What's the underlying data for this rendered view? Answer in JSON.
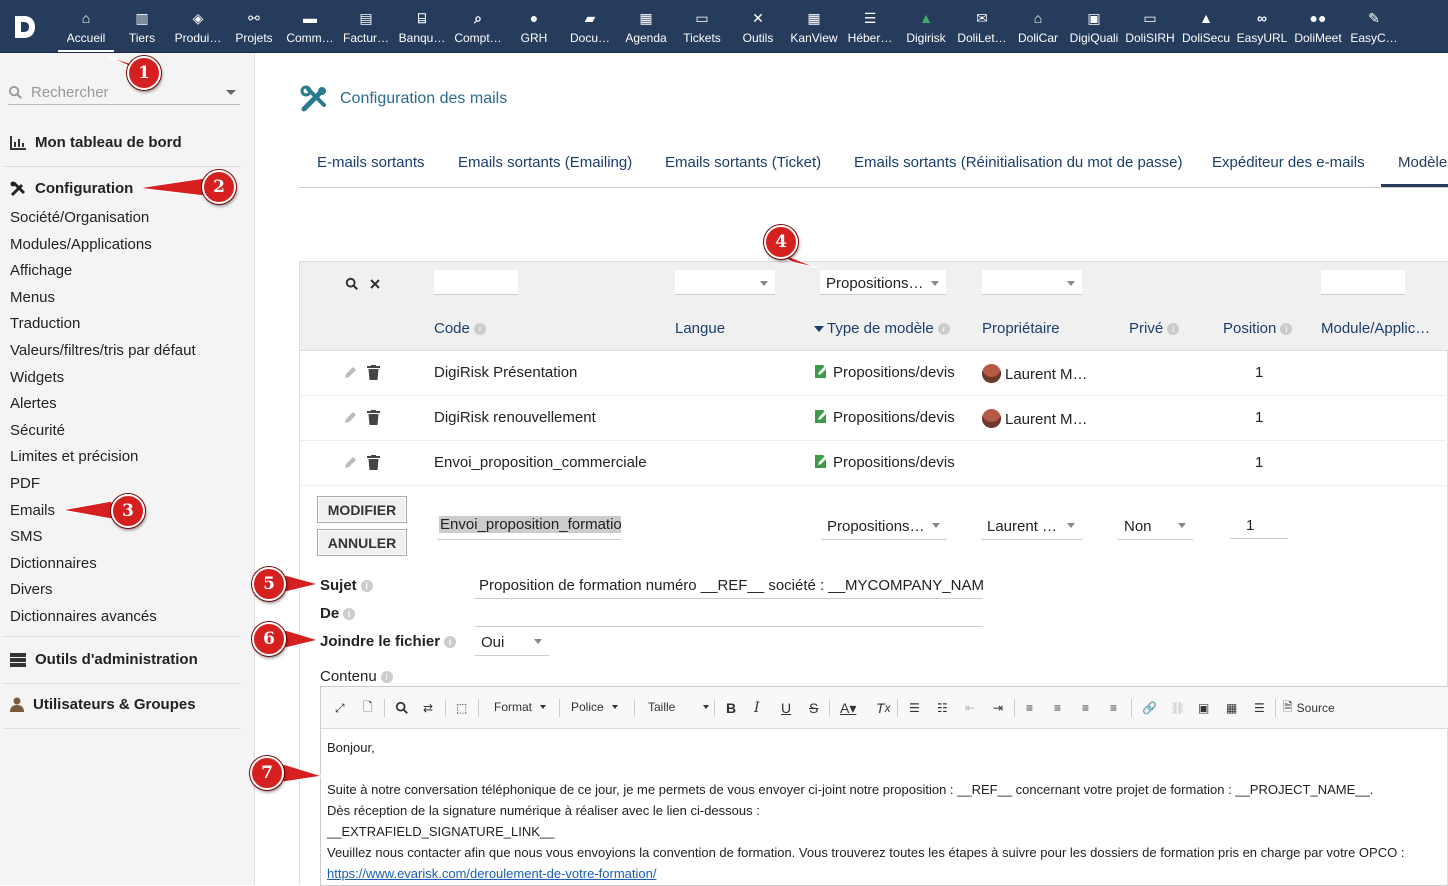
{
  "topbar": {
    "items": [
      {
        "label": "Accueil",
        "icon": "home-icon"
      },
      {
        "label": "Tiers",
        "icon": "building-icon"
      },
      {
        "label": "Produi…",
        "icon": "cube-icon"
      },
      {
        "label": "Projets",
        "icon": "sitemap-icon"
      },
      {
        "label": "Comm…",
        "icon": "suitcase-icon"
      },
      {
        "label": "Factur…",
        "icon": "invoice-icon"
      },
      {
        "label": "Banqu…",
        "icon": "bank-icon"
      },
      {
        "label": "Compt…",
        "icon": "search-dollar-icon"
      },
      {
        "label": "GRH",
        "icon": "user-icon"
      },
      {
        "label": "Docu…",
        "icon": "folder-icon"
      },
      {
        "label": "Agenda",
        "icon": "calendar-icon"
      },
      {
        "label": "Tickets",
        "icon": "ticket-icon"
      },
      {
        "label": "Outils",
        "icon": "tools-icon"
      },
      {
        "label": "KanView",
        "icon": "kanban-icon"
      },
      {
        "label": "Héber…",
        "icon": "server-icon"
      },
      {
        "label": "Digirisk",
        "icon": "digirisk-icon"
      },
      {
        "label": "DoliLet…",
        "icon": "letter-icon"
      },
      {
        "label": "DoliCar",
        "icon": "garage-icon"
      },
      {
        "label": "DigiQuali",
        "icon": "quality-icon"
      },
      {
        "label": "DoliSIRH",
        "icon": "id-card-icon"
      },
      {
        "label": "DoliSecu",
        "icon": "lock-icon"
      },
      {
        "label": "EasyURL",
        "icon": "link-icon"
      },
      {
        "label": "DoliMeet",
        "icon": "users-icon"
      },
      {
        "label": "EasyC…",
        "icon": "contract-icon"
      }
    ]
  },
  "sidebar": {
    "search_placeholder": "Rechercher",
    "dashboard": "Mon tableau de bord",
    "config": "Configuration",
    "config_items": [
      "Société/Organisation",
      "Modules/Applications",
      "Affichage",
      "Menus",
      "Traduction",
      "Valeurs/filtres/tris par défaut",
      "Widgets",
      "Alertes",
      "Sécurité",
      "Limites et précision",
      "PDF",
      "Emails",
      "SMS",
      "Dictionnaires",
      "Divers",
      "Dictionnaires avancés"
    ],
    "admin_tools": "Outils d'administration",
    "users_groups": "Utilisateurs & Groupes"
  },
  "page": {
    "title": "Configuration des mails",
    "tabs": [
      "E-mails sortants",
      "Emails sortants (Emailing)",
      "Emails sortants (Ticket)",
      "Emails sortants (Réinitialisation du mot de passe)",
      "Expéditeur des e-mails",
      "Modèles"
    ]
  },
  "table": {
    "filter_type_value": "Propositions…",
    "headers": {
      "code": "Code",
      "langue": "Langue",
      "type": "Type de modèle",
      "owner": "Propriétaire",
      "prive": "Privé",
      "position": "Position",
      "module": "Module/Applic…"
    },
    "rows": [
      {
        "code": "DigiRisk Présentation",
        "type": "Propositions/devis",
        "owner": "Laurent M…",
        "position": "1"
      },
      {
        "code": "DigiRisk renouvellement",
        "type": "Propositions/devis",
        "owner": "Laurent M…",
        "position": "1"
      },
      {
        "code": "Envoi_proposition_commerciale",
        "type": "Propositions/devis",
        "owner": "",
        "position": "1"
      }
    ],
    "edit_row": {
      "modify_label": "MODIFIER",
      "cancel_label": "ANNULER",
      "code": "Envoi_proposition_formatio",
      "type": "Propositions…",
      "owner": "Laurent …",
      "prive": "Non",
      "position": "1"
    }
  },
  "form": {
    "subject_label": "Sujet",
    "subject_value": "Proposition de formation numéro __REF__ société : __MYCOMPANY_NAME__",
    "from_label": "De",
    "attach_label": "Joindre le fichier",
    "attach_value": "Oui",
    "content_label": "Contenu"
  },
  "editor": {
    "toolbar": {
      "format": "Format",
      "police": "Police",
      "taille": "Taille",
      "source": "Source"
    },
    "lines": [
      "Bonjour,",
      "",
      "Suite à notre conversation téléphonique de ce jour, je me permets de vous envoyer ci-joint notre proposition : __REF__ concernant votre projet de formation : __PROJECT_NAME__.",
      "Dès réception de la signature numérique à réaliser avec le lien ci-dessous :",
      "__EXTRAFIELD_SIGNATURE_LINK__",
      "Veuillez nous contacter afin que nous vous envoyions la convention de formation. Vous trouverez toutes les étapes à suivre pour les dossiers de formation pris en charge par votre OPCO :"
    ],
    "link": "https://www.evarisk.com/deroulement-de-votre-formation/"
  },
  "annotations": [
    "1",
    "2",
    "3",
    "4",
    "5",
    "6",
    "7"
  ],
  "colors": {
    "topbar": "#263c5c",
    "link": "#1a3e6c",
    "annotation": "#d62020"
  }
}
